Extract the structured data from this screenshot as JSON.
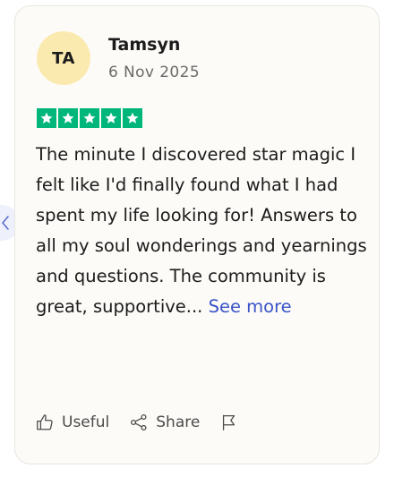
{
  "review": {
    "avatar_initials": "TA",
    "reviewer_name": "Tamsyn",
    "date": "6 Nov 2025",
    "rating": 5,
    "rating_max": 5,
    "text": "The minute I discovered star magic I felt like I'd finally found what I had spent my life looking for! Answers to all my soul wonderings and yearnings and questions. The community is great, supportive...",
    "see_more_label": "See more"
  },
  "actions": {
    "useful_label": "Useful",
    "share_label": "Share",
    "report_icon": "flag-icon"
  },
  "navigation": {
    "prev_icon": "chevron-left-icon"
  },
  "colors": {
    "star_green": "#00b67a",
    "avatar_bg": "#fbeab0",
    "link_blue": "#3a53c5",
    "card_bg": "#fcfbf8"
  }
}
